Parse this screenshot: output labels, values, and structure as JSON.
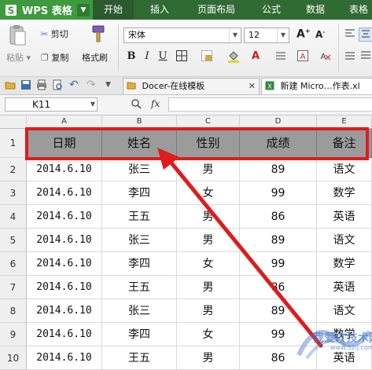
{
  "app": {
    "logo_text": "WPS 表格"
  },
  "menu": {
    "tabs": [
      {
        "label": "开始",
        "active": true
      },
      {
        "label": "插入"
      },
      {
        "label": "页面布局"
      },
      {
        "label": "公式"
      },
      {
        "label": "数据"
      },
      {
        "label": "表格"
      }
    ]
  },
  "ribbon": {
    "paste_label": "粘贴",
    "cut_label": "剪切",
    "copy_label": "复制",
    "format_painter_label": "格式刷",
    "font_name": "宋体",
    "font_size": "12"
  },
  "tabs": {
    "docer_label": "Docer-在线模板",
    "new_label": "新建 Micro…作表.xl"
  },
  "formula_bar": {
    "cell_ref": "K11",
    "fx_label": "fx",
    "value": ""
  },
  "sheet": {
    "columns": [
      "A",
      "B",
      "C",
      "D",
      "E"
    ],
    "row_numbers": [
      "1",
      "2",
      "3",
      "4",
      "5",
      "6",
      "7",
      "8",
      "9",
      "10"
    ],
    "header": [
      "日期",
      "姓名",
      "性别",
      "成绩",
      "备注"
    ],
    "rows": [
      [
        "2014.6.10",
        "张三",
        "男",
        "89",
        "语文"
      ],
      [
        "2014.6.10",
        "李四",
        "女",
        "99",
        "数学"
      ],
      [
        "2014.6.10",
        "王五",
        "男",
        "86",
        "英语"
      ],
      [
        "2014.6.10",
        "张三",
        "男",
        "89",
        "语文"
      ],
      [
        "2014.6.10",
        "李四",
        "女",
        "99",
        "数学"
      ],
      [
        "2014.6.10",
        "王五",
        "男",
        "86",
        "英语"
      ],
      [
        "2014.6.10",
        "张三",
        "男",
        "89",
        "语文"
      ],
      [
        "2014.6.10",
        "李四",
        "女",
        "99",
        "数学"
      ],
      [
        "2014.6.10",
        "王五",
        "男",
        "86",
        "英语"
      ]
    ]
  },
  "watermark": {
    "text": "我爱IT技术网",
    "url": "www.52ij.com"
  },
  "colors": {
    "title_bar": "#2f6b32",
    "logo_bg": "#3f9a3f",
    "header_fill": "#9b9b9b",
    "annotation_red": "#e01b1b"
  }
}
